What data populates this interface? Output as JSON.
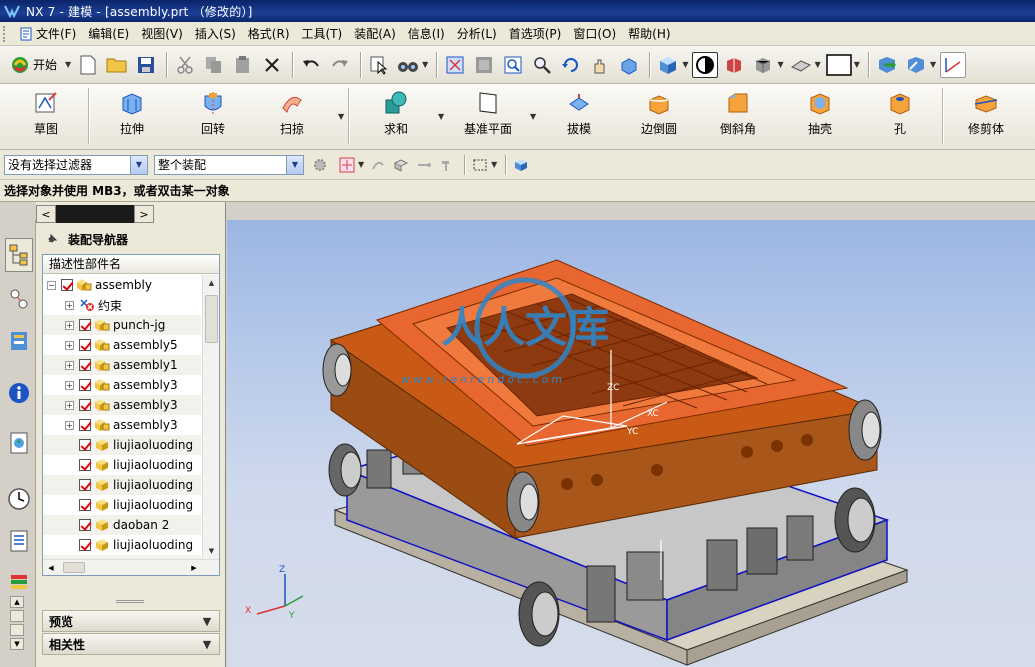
{
  "window": {
    "title": "NX 7 - 建模 - [assembly.prt （修改的）]"
  },
  "menubar": {
    "items": [
      {
        "label": "文件(F)"
      },
      {
        "label": "编辑(E)"
      },
      {
        "label": "视图(V)"
      },
      {
        "label": "插入(S)"
      },
      {
        "label": "格式(R)"
      },
      {
        "label": "工具(T)"
      },
      {
        "label": "装配(A)"
      },
      {
        "label": "信息(I)"
      },
      {
        "label": "分析(L)"
      },
      {
        "label": "首选项(P)"
      },
      {
        "label": "窗口(O)"
      },
      {
        "label": "帮助(H)"
      }
    ]
  },
  "toolbar": {
    "start_label": "开始"
  },
  "features": {
    "items": [
      {
        "label": "草图"
      },
      {
        "label": "拉伸"
      },
      {
        "label": "回转"
      },
      {
        "label": "扫掠"
      },
      {
        "label": "求和"
      },
      {
        "label": "基准平面"
      },
      {
        "label": "拔模"
      },
      {
        "label": "边倒圆"
      },
      {
        "label": "倒斜角"
      },
      {
        "label": "抽壳"
      },
      {
        "label": "孔"
      },
      {
        "label": "修剪体"
      }
    ]
  },
  "selection": {
    "filter_value": "没有选择过滤器",
    "scope_value": "整个装配"
  },
  "prompt": {
    "text": "选择对象并使用 MB3，或者双击某一对象"
  },
  "navigator": {
    "title": "装配导航器",
    "column_header": "描述性部件名",
    "rows": [
      {
        "label": "assembly"
      },
      {
        "label": "约束"
      },
      {
        "label": "punch-jg"
      },
      {
        "label": "assembly5"
      },
      {
        "label": "assembly1"
      },
      {
        "label": "assembly3"
      },
      {
        "label": "assembly3"
      },
      {
        "label": "assembly3"
      },
      {
        "label": "liujiaoluoding"
      },
      {
        "label": "liujiaoluoding"
      },
      {
        "label": "liujiaoluoding"
      },
      {
        "label": "liujiaoluoding"
      },
      {
        "label": "daoban 2"
      },
      {
        "label": "liujiaoluoding"
      },
      {
        "label": "liujiaoluoding"
      }
    ],
    "preview_label": "预览",
    "dependency_label": "相关性"
  },
  "viewport": {
    "watermark_text": "人人文库",
    "watermark_url": "www.renrendoc.com",
    "triad": {
      "x": "X",
      "y": "Y",
      "z": "Z"
    },
    "wcs": {
      "xc": "XC",
      "yc": "YC",
      "zc": "ZC"
    },
    "colors": {
      "top_plate": "#e8662f",
      "frame": "#b05a10",
      "steel": "#9a9a9a",
      "edges": "#1010c8"
    }
  }
}
